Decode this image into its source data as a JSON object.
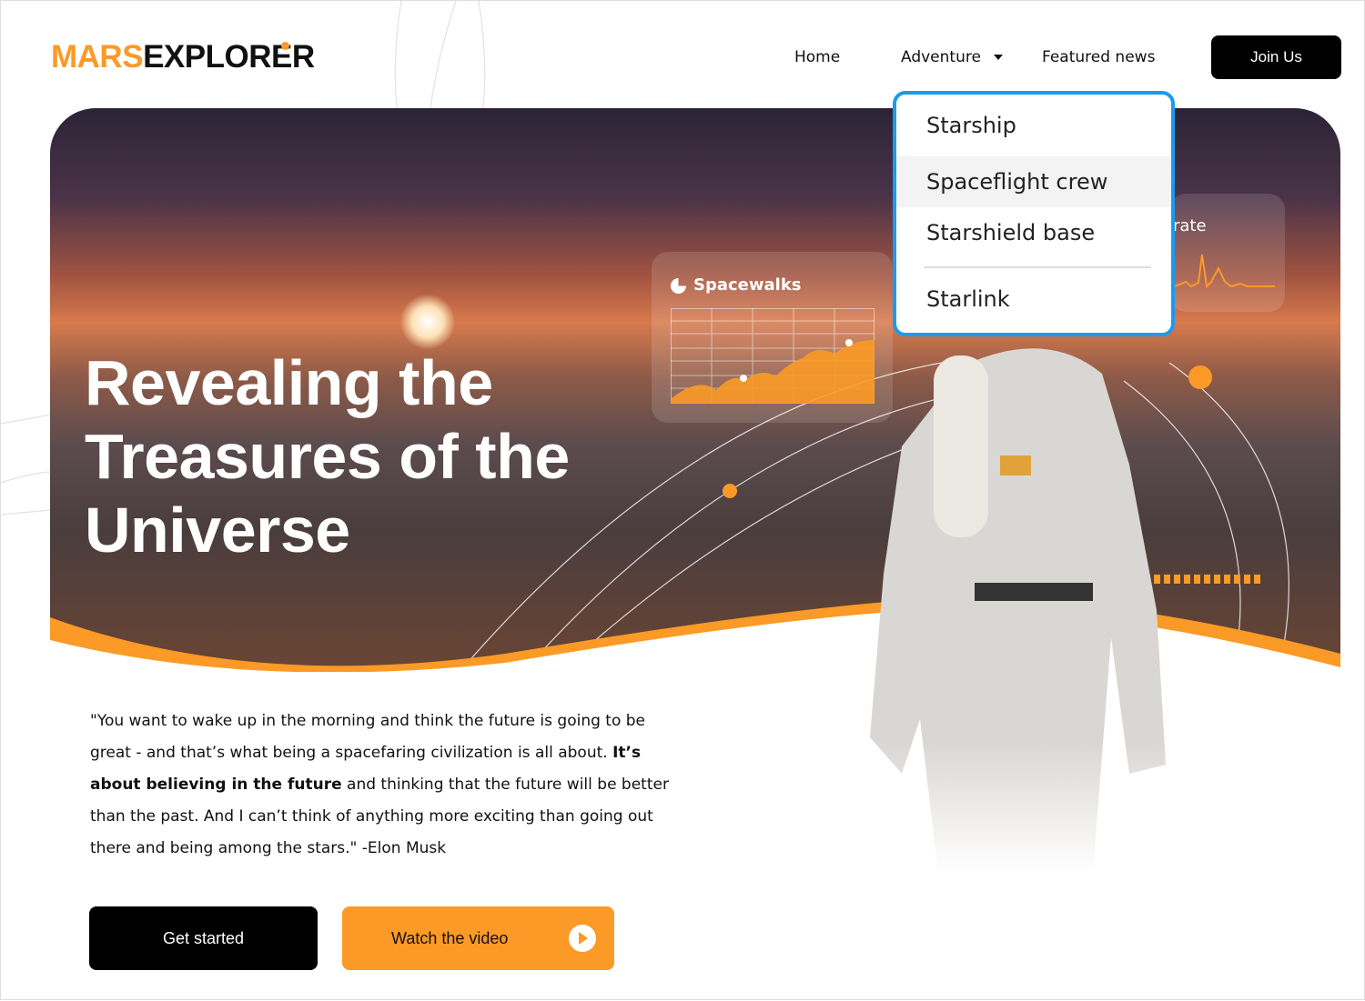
{
  "logo": {
    "part1": "MARS",
    "part2": "EXPLORER"
  },
  "nav": {
    "items": [
      "Home",
      "Adventure",
      "Featured news"
    ],
    "join": "Join Us"
  },
  "dropdown": {
    "items": [
      "Starship",
      "Spaceflight crew",
      "Starshield base",
      "Starlink"
    ],
    "hovered": "Spaceflight crew"
  },
  "hero": {
    "title_lines": [
      "Revealing the",
      "Treasures of the",
      "Universe"
    ],
    "cards": {
      "spacewalks": "Spacewalks",
      "rate": "rate"
    }
  },
  "quote": {
    "p1": "\"You want to wake up in the morning and think the future is going to be great - and that’s what being a spacefaring civilization is all about. ",
    "bold": "It’s about believing in the future",
    "p2": " and thinking that the future will be better than the past. And I can’t think of anything more exciting than going out there and being among the stars.\" -Elon Musk"
  },
  "buttons": {
    "get_started": "Get started",
    "watch": "Watch the video"
  },
  "colors": {
    "accent": "#fb9a26",
    "dropdown_border": "#1a9bf0"
  }
}
